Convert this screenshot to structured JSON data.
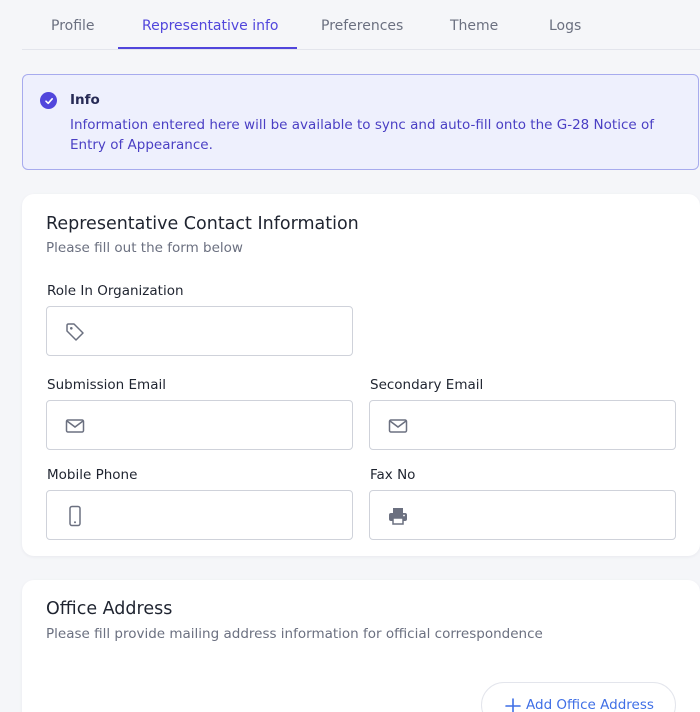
{
  "tabs": [
    {
      "label": "Profile",
      "active": false
    },
    {
      "label": "Representative info",
      "active": true
    },
    {
      "label": "Preferences",
      "active": false
    },
    {
      "label": "Theme",
      "active": false
    },
    {
      "label": "Logs",
      "active": false
    }
  ],
  "alert": {
    "icon": "check-circle-icon",
    "title": "Info",
    "text": "Information entered here will be available to sync and auto-fill onto the G-28 Notice of Entry of Appearance."
  },
  "contact": {
    "title": "Representative Contact Information",
    "subtitle": "Please fill out the form below",
    "fields": {
      "role": {
        "label": "Role In Organization",
        "value": "",
        "icon": "tag-icon"
      },
      "submission_email": {
        "label": "Submission Email",
        "value": "",
        "icon": "mail-icon"
      },
      "secondary_email": {
        "label": "Secondary Email",
        "value": "",
        "icon": "mail-icon"
      },
      "mobile_phone": {
        "label": "Mobile Phone",
        "value": "",
        "icon": "mobile-phone-icon"
      },
      "fax_no": {
        "label": "Fax No",
        "value": "",
        "icon": "printer-icon"
      }
    }
  },
  "office": {
    "title": "Office Address",
    "subtitle": "Please fill provide mailing address information for official correspondence",
    "add_button": "Add Office Address",
    "add_icon": "plus-icon"
  },
  "colors": {
    "accent": "#5146dc",
    "link": "#3f6fe6",
    "alert_bg": "#eef0fd",
    "page_bg": "#f5f6f9"
  }
}
